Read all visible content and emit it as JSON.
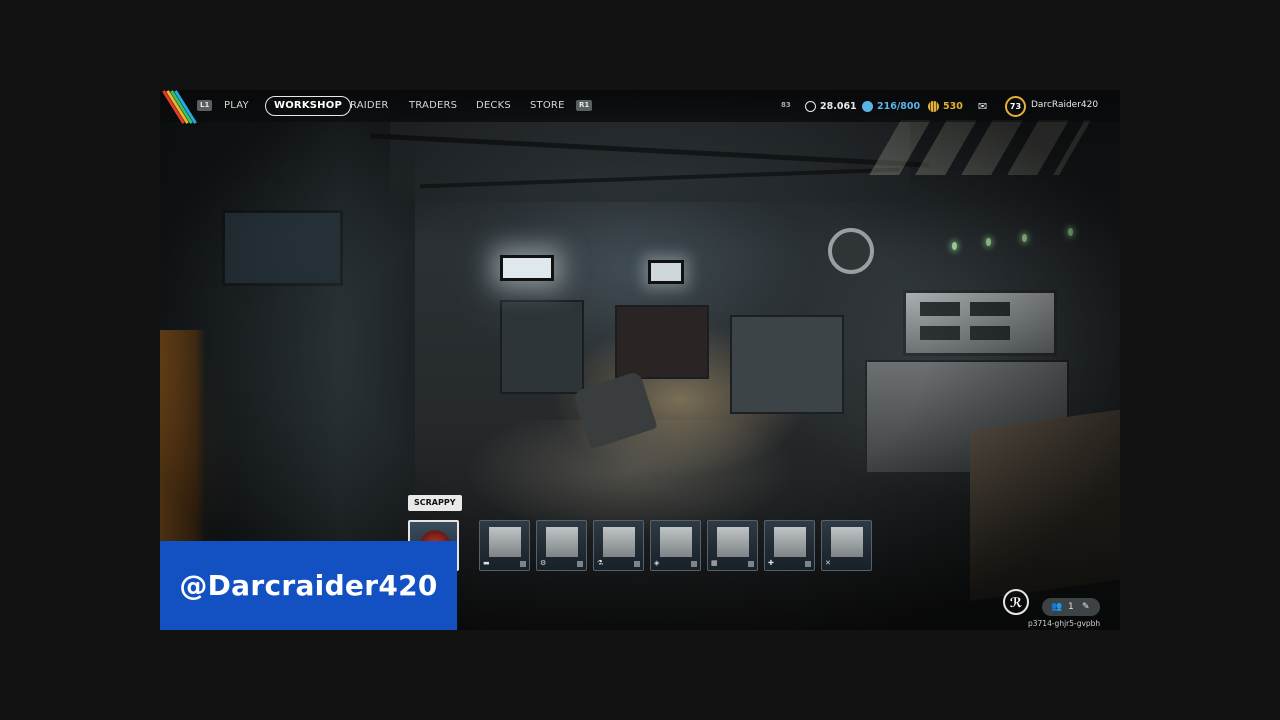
{
  "topbar": {
    "nav_prev_hint": "L1",
    "nav_next_hint": "R1",
    "nav": [
      {
        "label": "PLAY",
        "active": false
      },
      {
        "label": "WORKSHOP",
        "active": true
      },
      {
        "label": "RAIDER",
        "active": false
      },
      {
        "label": "TRADERS",
        "active": false
      },
      {
        "label": "DECKS",
        "active": false
      },
      {
        "label": "STORE",
        "active": false
      }
    ],
    "small_count": "83",
    "coins": "28.061",
    "storage": "216/800",
    "credits": "530",
    "level": "73",
    "username": "DarcRaider420"
  },
  "colors": {
    "storage_accent": "#5ab4e8",
    "credits_accent": "#e3b13a",
    "overlay_blue": "#1351c3"
  },
  "itembar": {
    "tooltip": "SCRAPPY",
    "slots": [
      {
        "icon": "rooster-icon",
        "selected": true
      },
      {
        "icon": "bed-icon",
        "selected": false
      },
      {
        "icon": "gear-icon",
        "selected": false
      },
      {
        "icon": "flask-icon",
        "selected": false
      },
      {
        "icon": "shield-icon",
        "selected": false
      },
      {
        "icon": "grid-icon",
        "selected": false
      },
      {
        "icon": "medkit-icon",
        "selected": false
      },
      {
        "icon": "crossed-tools-icon",
        "selected": false
      }
    ]
  },
  "party": {
    "count": "1"
  },
  "session_code": "p3714-ghjr5-gvpbh",
  "overlay": {
    "handle": "@Darcraider420"
  }
}
